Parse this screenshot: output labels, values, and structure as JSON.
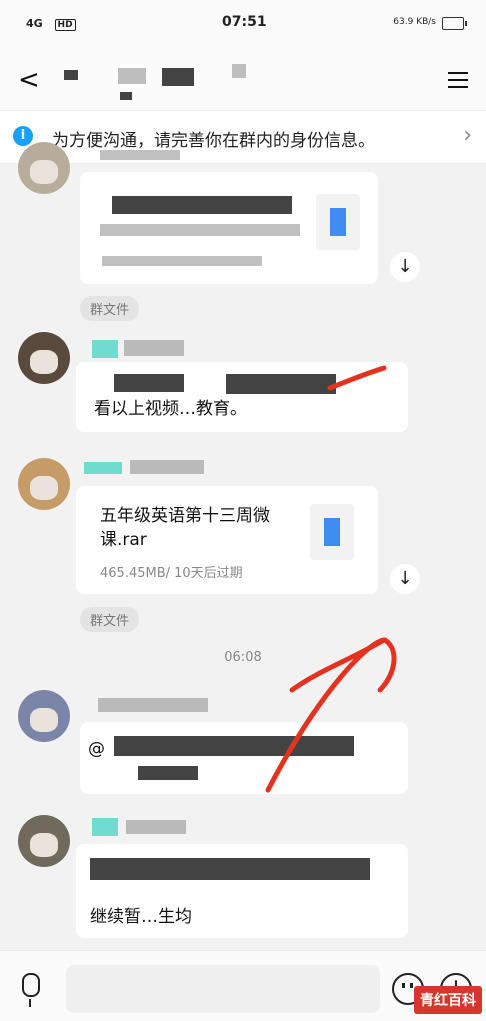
{
  "status": {
    "network": "4G",
    "hd": "HD",
    "time": "07:51",
    "speed": "63.9 KB/s"
  },
  "header": {
    "back": "<"
  },
  "banner": {
    "text": "为方便沟通，请完善你在群内的身份信息。"
  },
  "messages": {
    "file1_tag": "群文件",
    "file2": {
      "name": "五年级英语第十三周微课.rar",
      "meta": "465.45MB/ 10天后过期",
      "tag": "群文件"
    },
    "text1_fragment": "看以上视频…教育。",
    "timestamp": "06:08",
    "mention_fragment": "@",
    "text2_fragment": "继续暂…生均"
  },
  "input": {
    "placeholder": ""
  },
  "watermark": "青红百科"
}
